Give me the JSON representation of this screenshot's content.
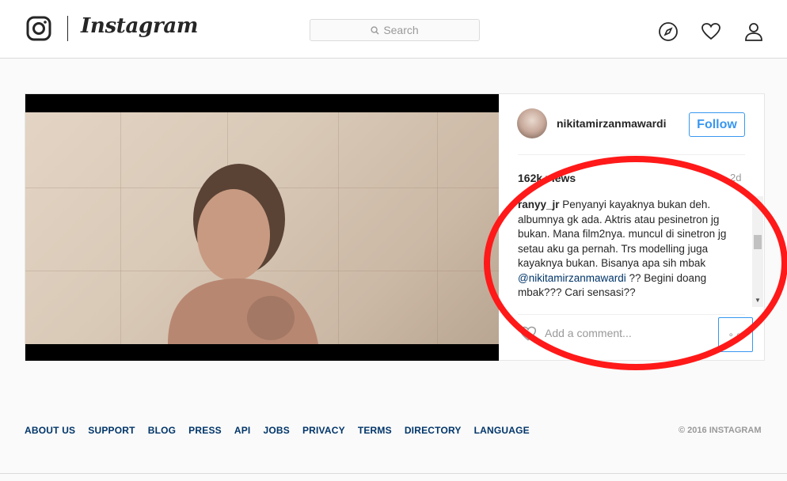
{
  "header": {
    "wordmark": "Instagram",
    "search_placeholder": "Search"
  },
  "post": {
    "username": "nikitamirzanmawardi",
    "follow_label": "Follow",
    "views": "162k views",
    "age": "2d",
    "comment": {
      "user": "ranyy_jr",
      "text_before": " Penyanyi kayaknya bukan deh. albumnya gk ada. Aktris atau pesinetron jg bukan. Mana film2nya. muncul di sinetron jg setau aku ga pernah. Trs modelling juga kayaknya bukan. Bisanya apa sih mbak ",
      "mention": "@nikitamirzanmawardi",
      "text_after": " ?? Begini doang mbak??? Cari sensasi??"
    },
    "add_comment_placeholder": "Add a comment...",
    "more_label": "∘∘"
  },
  "footer": {
    "links": [
      "ABOUT US",
      "SUPPORT",
      "BLOG",
      "PRESS",
      "API",
      "JOBS",
      "PRIVACY",
      "TERMS",
      "DIRECTORY",
      "LANGUAGE"
    ],
    "copyright": "© 2016 INSTAGRAM"
  },
  "colors": {
    "annotation": "#ff1919",
    "link_blue": "#3897f0",
    "footer_link": "#003569"
  }
}
